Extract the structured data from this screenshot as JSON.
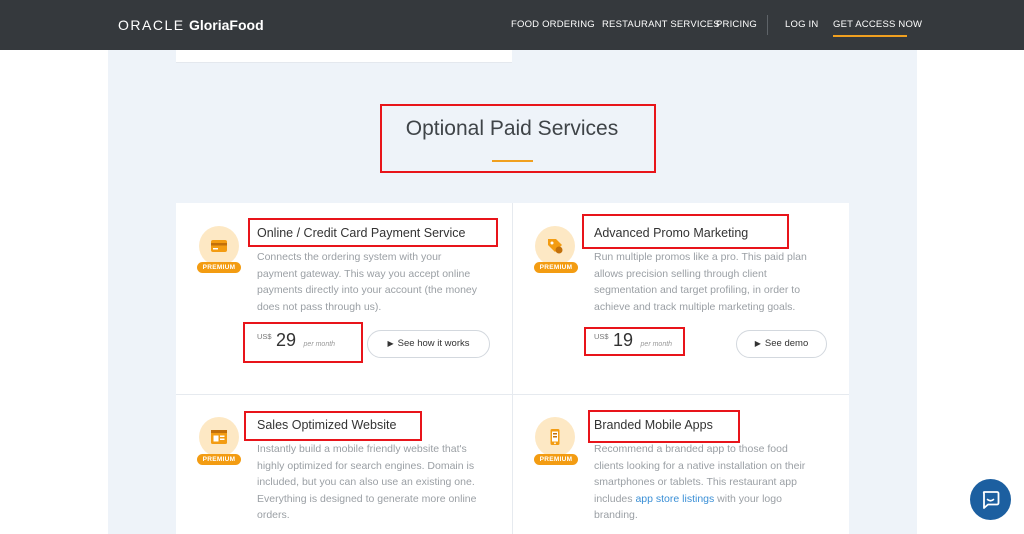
{
  "header": {
    "logo_oracle": "ORACLE",
    "logo_product": "GloriaFood",
    "nav": {
      "food_ordering": "FOOD ORDERING",
      "restaurant_services": "RESTAURANT SERVICES",
      "pricing": "PRICING",
      "login": "LOG IN",
      "get_access": "GET ACCESS NOW"
    }
  },
  "section": {
    "title": "Optional Paid Services"
  },
  "services": [
    {
      "title": "Online / Credit Card Payment Service",
      "badge": "PREMIUM",
      "icon": "credit-card-icon",
      "desc": [
        "Connects the ordering system with your",
        "payment gateway. This way you accept online",
        "payments directly into your account (the money",
        "does not pass through us)."
      ],
      "price": {
        "currency": "US$",
        "amount": "29",
        "period": "per month"
      },
      "button": "See how it works"
    },
    {
      "title": "Advanced Promo Marketing",
      "badge": "PREMIUM",
      "icon": "promo-tag-icon",
      "desc": [
        "Run multiple promos like a pro. This paid plan",
        "allows precision selling through client",
        "segmentation and target profiling, in order to",
        "achieve and track multiple marketing goals."
      ],
      "price": {
        "currency": "US$",
        "amount": "19",
        "period": "per month"
      },
      "button": "See demo"
    },
    {
      "title": "Sales Optimized Website",
      "badge": "PREMIUM",
      "icon": "website-icon",
      "desc": [
        "Instantly build a mobile friendly website that's",
        "highly optimized for search engines. Domain is",
        "included, but you can also use an existing one.",
        "Everything is designed to generate more online",
        "orders."
      ]
    },
    {
      "title": "Branded Mobile Apps",
      "badge": "PREMIUM",
      "icon": "mobile-app-icon",
      "desc": [
        "Recommend a branded app to those food",
        "clients looking for a native installation on their",
        "smartphones or tablets. This restaurant app"
      ],
      "desc_link_pre": "includes ",
      "desc_link": "app store listings",
      "desc_link_post": " with your logo",
      "desc_last": "branding."
    }
  ],
  "colors": {
    "accent": "#f39c12",
    "header_bg": "#35393d",
    "highlight": "#e8141a",
    "chat": "#1c5fa0"
  }
}
